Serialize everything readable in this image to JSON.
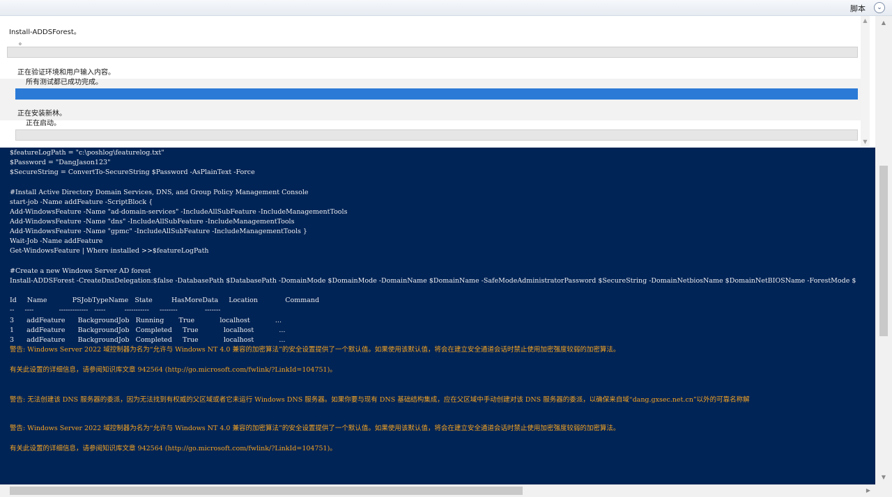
{
  "topbar": {
    "script_label": "脚本",
    "collapse_icon": "⌄"
  },
  "progress": {
    "item1": {
      "title": "Install-ADDSForest。",
      "sub": "。"
    },
    "item2": {
      "title": "正在验证环境和用户输入内容。",
      "sub": "所有测试都已成功完成。",
      "progress": 1.0
    },
    "item3": {
      "title": "正在安装新林。",
      "sub": "正在启动。",
      "progress": 0.0
    }
  },
  "console": {
    "lines": [
      "$featureLogPath = \"c:\\poshlog\\featurelog.txt\"",
      "$Password = \"DangJason123\"",
      "$SecureString = ConvertTo-SecureString $Password -AsPlainText -Force",
      "",
      "#Install Active Directory Domain Services, DNS, and Group Policy Management Console",
      "start-job -Name addFeature -ScriptBlock {",
      "Add-WindowsFeature -Name \"ad-domain-services\" -IncludeAllSubFeature -IncludeManagementTools",
      "Add-WindowsFeature -Name \"dns\" -IncludeAllSubFeature -IncludeManagementTools",
      "Add-WindowsFeature -Name \"gpmc\" -IncludeAllSubFeature -IncludeManagementTools }",
      "Wait-Job -Name addFeature",
      "Get-WindowsFeature | Where installed >>$featureLogPath",
      "",
      "#Create a new Windows Server AD forest",
      "Install-ADDSForest -CreateDnsDelegation:$false -DatabasePath $DatabasePath -DomainMode $DomainMode -DomainName $DomainName -SafeModeAdministratorPassword $SecureString -DomainNetbiosName $DomainNetBIOSName -ForestMode $",
      "",
      "Id     Name            PSJobTypeName   State         HasMoreData     Location             Command",
      "--     ----            -------------   -----         -----------     --------             -------",
      "3      addFeature      BackgroundJob   Running       True            localhost            ...",
      "1      addFeature      BackgroundJob   Completed     True            localhost            ...",
      "3      addFeature      BackgroundJob   Completed     True            localhost            ..."
    ],
    "warnings": [
      "警告: Windows Server 2022 域控制器为名为“允许与 Windows NT 4.0 兼容的加密算法”的安全设置提供了一个默认值。如果使用该默认值，将会在建立安全通道会话时禁止使用加密强度较弱的加密算法。",
      "有关此设置的详细信息，请参阅知识库文章 942564 (http://go.microsoft.com/fwlink/?LinkId=104751)。",
      "警告: 无法创建该 DNS 服务器的委派，因为无法找到有权威的父区域或者它未运行 Windows DNS 服务器。如果你要与现有 DNS 基础结构集成，应在父区域中手动创建对该 DNS 服务器的委派，以确保来自域“dang.gxsec.net.cn”以外的可靠名称解",
      "警告: Windows Server 2022 域控制器为名为“允许与 Windows NT 4.0 兼容的加密算法”的安全设置提供了一个默认值。如果使用该默认值，将会在建立安全通道会话时禁止使用加密强度较弱的加密算法。",
      "有关此设置的详细信息，请参阅知识库文章 942564 (http://go.microsoft.com/fwlink/?LinkId=104751)。"
    ]
  }
}
